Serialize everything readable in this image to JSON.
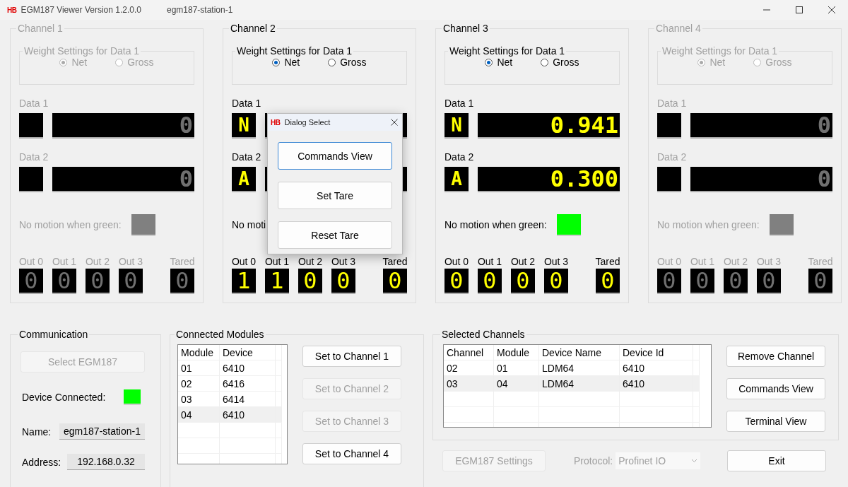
{
  "window": {
    "logo": "HB",
    "title": "EGM187 Viewer Version 1.2.0.0",
    "subtitle": "egm187-station-1"
  },
  "channels": [
    {
      "title": "Channel 1",
      "enabled": false,
      "weight_legend": "Weight Settings for Data 1",
      "options": [
        {
          "label": "Net",
          "selected": true
        },
        {
          "label": "Gross",
          "selected": false
        }
      ],
      "data": [
        {
          "label": "Data 1",
          "value": "0"
        },
        {
          "label": "Data 2",
          "value": "0"
        }
      ],
      "motion": {
        "label": "No motion when green:",
        "color": "#808080"
      },
      "outputs": [
        {
          "label": "Out 0",
          "value": "0"
        },
        {
          "label": "Out 1",
          "value": "0"
        },
        {
          "label": "Out 2",
          "value": "0"
        },
        {
          "label": "Out 3",
          "value": "0"
        }
      ],
      "tared": {
        "label": "Tared",
        "value": "0"
      }
    },
    {
      "title": "Channel 2",
      "enabled": true,
      "weight_legend": "Weight Settings for Data 1",
      "options": [
        {
          "label": "Net",
          "selected": true
        },
        {
          "label": "Gross",
          "selected": false
        }
      ],
      "data": [
        {
          "label": "Data 1",
          "unit": "N"
        },
        {
          "label": "Data 2",
          "unit": "A"
        }
      ],
      "motion": {
        "label": "No moti"
      },
      "outputs": [
        {
          "label": "Out 0",
          "value": "1"
        },
        {
          "label": "Out 1",
          "value": "1"
        },
        {
          "label": "Out 2",
          "value": "0"
        },
        {
          "label": "Out 3",
          "value": "0"
        }
      ],
      "tared": {
        "label": "Tared",
        "value": "0"
      }
    },
    {
      "title": "Channel 3",
      "enabled": true,
      "weight_legend": "Weight Settings for Data 1",
      "options": [
        {
          "label": "Net",
          "selected": true
        },
        {
          "label": "Gross",
          "selected": false
        }
      ],
      "data": [
        {
          "label": "Data 1",
          "unit": "N",
          "value": "0.941"
        },
        {
          "label": "Data 2",
          "unit": "A",
          "value": "0.300"
        }
      ],
      "motion": {
        "label": "No motion when green:",
        "color": "#00ff00"
      },
      "outputs": [
        {
          "label": "Out 0",
          "value": "0"
        },
        {
          "label": "Out 1",
          "value": "0"
        },
        {
          "label": "Out 2",
          "value": "0"
        },
        {
          "label": "Out 3",
          "value": "0"
        }
      ],
      "tared": {
        "label": "Tared",
        "value": "0"
      }
    },
    {
      "title": "Channel 4",
      "enabled": false,
      "weight_legend": "Weight Settings for Data 1",
      "options": [
        {
          "label": "Net",
          "selected": true
        },
        {
          "label": "Gross",
          "selected": false
        }
      ],
      "data": [
        {
          "label": "Data 1",
          "value": "0"
        },
        {
          "label": "Data 2",
          "value": "0"
        }
      ],
      "motion": {
        "label": "No motion when green:",
        "color": "#808080"
      },
      "outputs": [
        {
          "label": "Out 0",
          "value": "0"
        },
        {
          "label": "Out 1",
          "value": "0"
        },
        {
          "label": "Out 2",
          "value": "0"
        },
        {
          "label": "Out 3",
          "value": "0"
        }
      ],
      "tared": {
        "label": "Tared",
        "value": "0"
      }
    }
  ],
  "dialog": {
    "logo": "HB",
    "title": "Dialog Select",
    "buttons": [
      {
        "label": "Commands View",
        "focused": true
      },
      {
        "label": "Set Tare",
        "focused": false
      },
      {
        "label": "Reset Tare",
        "focused": false
      }
    ]
  },
  "communication": {
    "title": "Communication",
    "select_button": {
      "label": "Select EGM187",
      "disabled": true
    },
    "connected": {
      "label": "Device Connected:",
      "color": "#00ff00"
    },
    "name": {
      "label": "Name:",
      "value": "egm187-station-1"
    },
    "address": {
      "label": "Address:",
      "value": "192.168.0.32"
    }
  },
  "connected_modules": {
    "title": "Connected Modules",
    "columns": [
      "Module",
      "Device"
    ],
    "rows": [
      {
        "cells": [
          "01",
          "6410"
        ],
        "selected": false
      },
      {
        "cells": [
          "02",
          "6416"
        ],
        "selected": false
      },
      {
        "cells": [
          "03",
          "6414"
        ],
        "selected": false
      },
      {
        "cells": [
          "04",
          "6410"
        ],
        "selected": true
      }
    ],
    "buttons": [
      {
        "label": "Set to Channel 1",
        "disabled": false
      },
      {
        "label": "Set to Channel 2",
        "disabled": true
      },
      {
        "label": "Set to Channel 3",
        "disabled": true
      },
      {
        "label": "Set to Channel 4",
        "disabled": false
      }
    ]
  },
  "selected_channels": {
    "title": "Selected Channels",
    "columns": [
      "Channel",
      "Module",
      "Device Name",
      "Device Id"
    ],
    "rows": [
      {
        "cells": [
          "02",
          "01",
          "LDM64",
          "6410"
        ],
        "selected": false
      },
      {
        "cells": [
          "03",
          "04",
          "LDM64",
          "6410"
        ],
        "selected": true
      }
    ],
    "buttons": [
      {
        "label": "Remove Channel",
        "disabled": false
      },
      {
        "label": "Commands View",
        "disabled": false
      },
      {
        "label": "Terminal View",
        "disabled": false
      }
    ]
  },
  "footer": {
    "settings_button": {
      "label": "EGM187 Settings",
      "disabled": true
    },
    "protocol": {
      "label": "Protocol:",
      "value": "Profinet IO",
      "disabled": true
    },
    "exit_button": {
      "label": "Exit",
      "disabled": false
    }
  }
}
